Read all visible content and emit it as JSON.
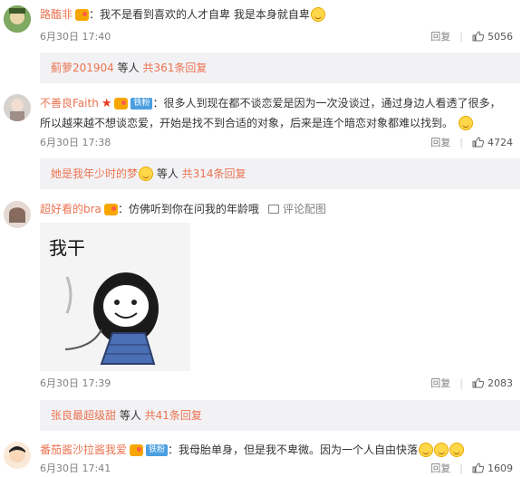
{
  "comments": [
    {
      "username": "路醢非",
      "text": "：我不是看到喜欢的人才自卑 我是本身就自卑",
      "time": "6月30日 17:40",
      "reply_label": "回复",
      "likes": "5056",
      "replies_who": "蓟萝201904",
      "replies_mid": " 等人 ",
      "replies_count": "共361条回复"
    },
    {
      "username": "不善良Faith",
      "badge": "铁粉",
      "text1": "：很多人到现在都不谈恋爱是因为一次没谈过，通过身边人看透了很多，",
      "text2": "所以越来越不想谈恋爱，开始是找不到合适的对象，后来是连个暗恋对象都难以找到。",
      "time": "6月30日 17:38",
      "reply_label": "回复",
      "likes": "4724",
      "replies_who": "她是我年少时的梦",
      "replies_mid": " 等人 ",
      "replies_count": "共314条回复"
    },
    {
      "username": "超好看的bra",
      "text": "：仿佛听到你在问我的年龄哦",
      "pic_label": "评论配图",
      "sticker_text": "我干",
      "time": "6月30日 17:39",
      "reply_label": "回复",
      "likes": "2083",
      "replies_who": "张良最超级甜",
      "replies_mid": " 等人 ",
      "replies_count": "共41条回复"
    },
    {
      "username": "番茄酱沙拉酱我爱",
      "badge": "铁粉",
      "text": "：我母胎单身，但是我不卑微。因为一个人自由快落",
      "time": "6月30日 17:41",
      "reply_label": "回复",
      "likes": "1609"
    }
  ]
}
